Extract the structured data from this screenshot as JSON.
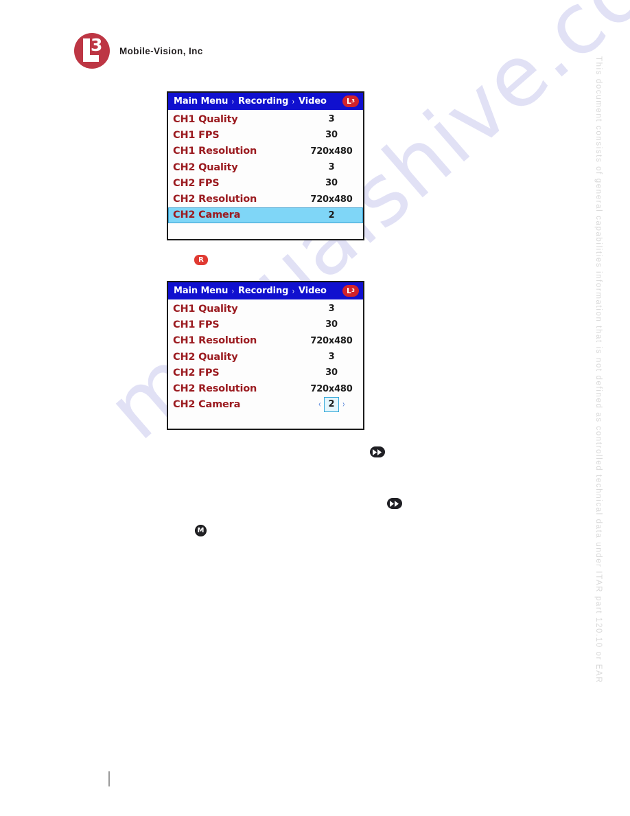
{
  "header": {
    "logo_name": "L3",
    "logo_letter": "L",
    "logo_digit": "3",
    "wordmark": "Mobile-Vision, Inc"
  },
  "watermarks": {
    "site": "manualshive.com",
    "itar_notice": "This document consists of general capabilities information that is not defined as controlled technical data under ITAR part 120.10 or EAR"
  },
  "colors": {
    "titlebar_blue": "#1010CF",
    "label_red": "#9B1B20",
    "selection_cyan": "#7FD6F7",
    "selection_border": "#3B9FD0",
    "badge_red": "#D2232A",
    "record_key_red": "#E03A32",
    "key_dark": "#1F1F24",
    "stepper_border": "#34A8D8",
    "chevron_blue": "#4C7FD8"
  },
  "panels": [
    {
      "id": "video-menu-selected",
      "breadcrumb": [
        "Main Menu",
        "Recording",
        "Video"
      ],
      "separator": "›",
      "badge": {
        "letter": "L",
        "sup": "3"
      },
      "rows": [
        {
          "label": "CH1 Quality",
          "value": "3",
          "state": "normal"
        },
        {
          "label": "CH1 FPS",
          "value": "30",
          "state": "normal"
        },
        {
          "label": "CH1 Resolution",
          "value": "720x480",
          "state": "normal"
        },
        {
          "label": "CH2 Quality",
          "value": "3",
          "state": "normal"
        },
        {
          "label": "CH2 FPS",
          "value": "30",
          "state": "normal"
        },
        {
          "label": "CH2 Resolution",
          "value": "720x480",
          "state": "normal"
        },
        {
          "label": "CH2 Camera",
          "value": "2",
          "state": "selected"
        }
      ]
    },
    {
      "id": "video-menu-editing",
      "breadcrumb": [
        "Main Menu",
        "Recording",
        "Video"
      ],
      "separator": "›",
      "badge": {
        "letter": "L",
        "sup": "3"
      },
      "rows": [
        {
          "label": "CH1 Quality",
          "value": "3",
          "state": "normal"
        },
        {
          "label": "CH1 FPS",
          "value": "30",
          "state": "normal"
        },
        {
          "label": "CH1 Resolution",
          "value": "720x480",
          "state": "normal"
        },
        {
          "label": "CH2 Quality",
          "value": "3",
          "state": "normal"
        },
        {
          "label": "CH2 FPS",
          "value": "30",
          "state": "normal"
        },
        {
          "label": "CH2 Resolution",
          "value": "720x480",
          "state": "normal"
        },
        {
          "label": "CH2 Camera",
          "value": "2",
          "state": "editing",
          "prev_arrow": "‹",
          "next_arrow": "›"
        }
      ]
    }
  ],
  "keys": {
    "record": "R",
    "menu": "M",
    "fast_forward_label": "fast-forward"
  },
  "page_tick": ""
}
